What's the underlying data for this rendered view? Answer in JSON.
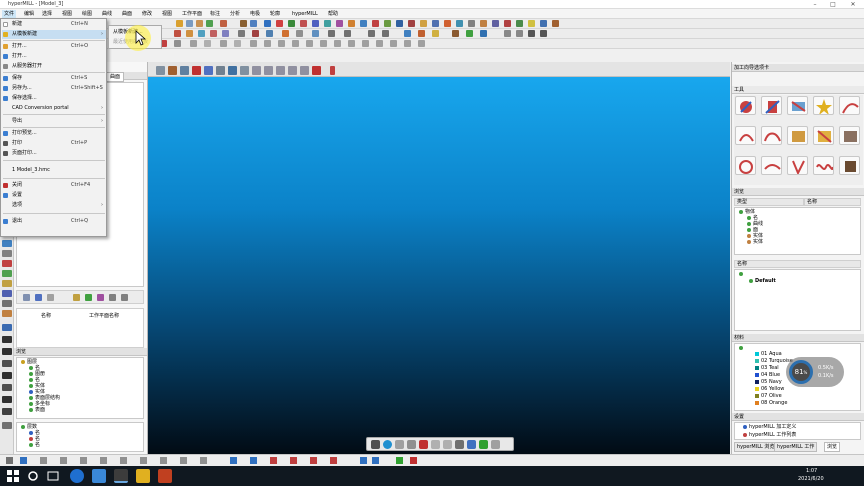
{
  "window": {
    "title": "hyperMILL - [Model_3]",
    "min": "–",
    "max": "□",
    "close": "✕"
  },
  "menubar": [
    "文件",
    "编辑",
    "选择",
    "视图",
    "绘图",
    "曲线",
    "曲面",
    "修改",
    "视图",
    "工作平面",
    "标注",
    "分析",
    "电极",
    "轮廓",
    "hyperMILL",
    "帮助"
  ],
  "file_menu": [
    {
      "label": "新建",
      "shortcut": "Ctrl+N",
      "color": "#ffffff"
    },
    {
      "label": "从模板新建",
      "shortcut": "",
      "arrow": "›",
      "color": "#e0b020",
      "highlighted": true
    },
    {
      "label": "打开...",
      "shortcut": "Ctrl+O",
      "color": "#e0a030"
    },
    {
      "label": "打开...",
      "shortcut": "",
      "color": "#3b7ed1"
    },
    {
      "label": "从服务器打开",
      "shortcut": "",
      "color": "#888888"
    },
    {
      "label": "保存",
      "shortcut": "Ctrl+S",
      "color": "#3b7ed1"
    },
    {
      "label": "另存为...",
      "shortcut": "Ctrl+Shift+S",
      "color": "#3b7ed1"
    },
    {
      "label": "保存选择...",
      "shortcut": "",
      "color": "#3b7ed1"
    },
    {
      "label": "CAD Conversion portal",
      "shortcut": "",
      "arrow": "›",
      "color": "#f0f0f0"
    },
    {
      "label": "导出",
      "shortcut": "",
      "arrow": "›",
      "color": "#f0f0f0"
    },
    {
      "label": "打印预览...",
      "shortcut": "",
      "color": "#3b7ed1"
    },
    {
      "label": "打印",
      "shortcut": "Ctrl+P",
      "color": "#555555"
    },
    {
      "label": "页面打印...",
      "shortcut": "",
      "color": "#555555"
    },
    {
      "label": "1 Model_3.hmc",
      "shortcut": "",
      "color": "#f0f0f0"
    },
    {
      "label": "关闭",
      "shortcut": "Ctrl+F4",
      "color": "#c03030"
    },
    {
      "label": "设置",
      "shortcut": "",
      "color": "#3b7ed1"
    },
    {
      "label": "选项",
      "shortcut": "",
      "arrow": "›",
      "color": "#f0f0f0"
    },
    {
      "label": "退出",
      "shortcut": "Ctrl+Q",
      "color": "#3b7ed1"
    }
  ],
  "submenu": {
    "items": [
      "从模板新建...",
      "最近使用的模板"
    ]
  },
  "left_panel": {
    "tab_label": "曲面",
    "col_name": "名称",
    "col_plane": "工作平面名称",
    "browser_title": "浏览",
    "tree": [
      "图层",
      "名",
      "图册",
      "名",
      "实体",
      "实体",
      "表面层结构",
      "多坐标",
      "表面"
    ],
    "tree2": [
      "层数",
      "名",
      "名",
      "名"
    ]
  },
  "right_panel": {
    "title": "加工向导选项卡",
    "tools_label": "工具",
    "browser_label": "浏览",
    "col_type": "类型",
    "col_name": "名称",
    "tree": [
      "物体",
      "名",
      "曲线",
      "面",
      "实体",
      "实体"
    ],
    "col_name2": "名称",
    "default_item": "Default",
    "materials_header": "材料",
    "materials": [
      {
        "name": "01 Aqua",
        "color": "#00c8d8"
      },
      {
        "name": "02 Turquoise",
        "color": "#30c0b0"
      },
      {
        "name": "03 Teal",
        "color": "#008080"
      },
      {
        "name": "04 Blue",
        "color": "#2050d0"
      },
      {
        "name": "05 Navy",
        "color": "#102060"
      },
      {
        "name": "06 Yellow",
        "color": "#e8d020"
      },
      {
        "name": "07 Olive",
        "color": "#808020"
      },
      {
        "name": "08 Orange",
        "color": "#e08020"
      }
    ],
    "bottom_tabs": [
      "设置",
      "hyperMILL 浏览器",
      "hyperMILL 工作",
      "浏览"
    ],
    "bottom_tree": [
      "hyperMILL 加工定义",
      "hyperMILL 工作列表"
    ]
  },
  "stat_widget": {
    "percent": "81",
    "unit": "%",
    "up": "0.5K/s",
    "down": "0.1K/s"
  },
  "taskbar": {
    "time": "1:07",
    "date": "2021/6/20"
  },
  "colors": {
    "accent": "#0b82c8",
    "menu_highlight": "#c6def2"
  }
}
